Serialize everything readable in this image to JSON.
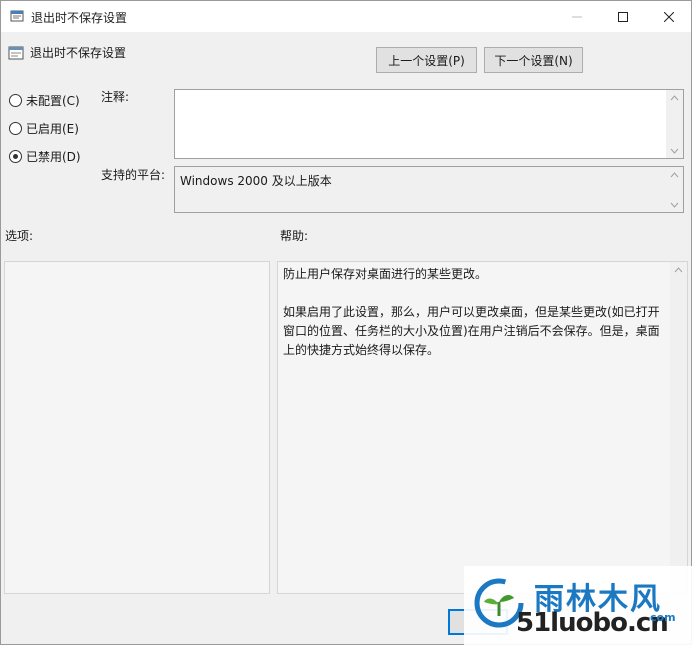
{
  "window": {
    "title": "退出时不保存设置"
  },
  "header": {
    "setting_name": "退出时不保存设置",
    "prev_button": "上一个设置(P)",
    "next_button": "下一个设置(N)"
  },
  "state": {
    "options": [
      {
        "label": "未配置(C)",
        "checked": false
      },
      {
        "label": "已启用(E)",
        "checked": false
      },
      {
        "label": "已禁用(D)",
        "checked": true
      }
    ]
  },
  "fields": {
    "comment_label": "注释:",
    "comment_value": "",
    "platform_label": "支持的平台:",
    "platform_value": "Windows 2000 及以上版本"
  },
  "sections": {
    "options_label": "选项:",
    "help_label": "帮助:"
  },
  "help": {
    "paragraph1": "防止用户保存对桌面进行的某些更改。",
    "paragraph2": "如果启用了此设置，那么，用户可以更改桌面，但是某些更改(如已打开窗口的位置、任务栏的大小及位置)在用户注销后不会保存。但是，桌面上的快捷方式始终得以保存。"
  },
  "watermark": {
    "brand": "雨林木风",
    "url": "51luobo.cn",
    "suffix": "com"
  },
  "colors": {
    "accent": "#0078d7",
    "window_bg": "#f0f0f0",
    "watermark_blue": "#1a79c2"
  }
}
